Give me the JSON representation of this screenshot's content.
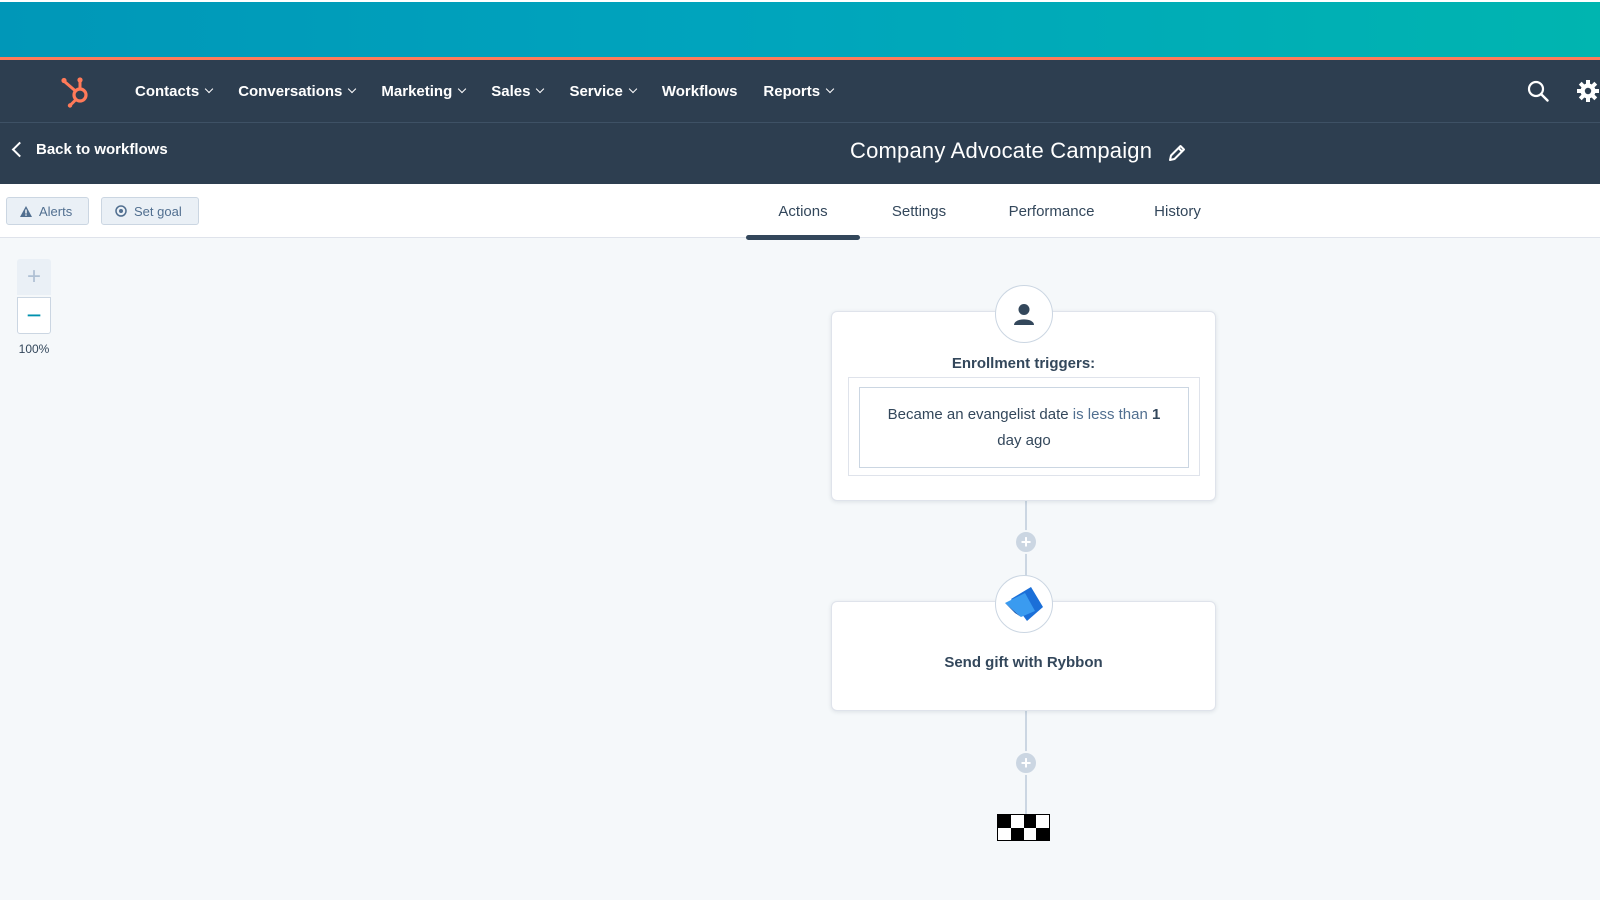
{
  "nav": {
    "items": [
      {
        "label": "Contacts",
        "dropdown": true
      },
      {
        "label": "Conversations",
        "dropdown": true
      },
      {
        "label": "Marketing",
        "dropdown": true
      },
      {
        "label": "Sales",
        "dropdown": true
      },
      {
        "label": "Service",
        "dropdown": true
      },
      {
        "label": "Workflows",
        "dropdown": false
      },
      {
        "label": "Reports",
        "dropdown": true
      }
    ],
    "icons": {
      "logo": "hubspot-sprocket-icon",
      "search": "search-icon",
      "settings": "gear-icon"
    }
  },
  "subheader": {
    "back_label": "Back to workflows",
    "title": "Company Advocate Campaign"
  },
  "toolbar": {
    "alerts_label": "Alerts",
    "set_goal_label": "Set goal"
  },
  "tabs": [
    {
      "label": "Actions",
      "active": true
    },
    {
      "label": "Settings",
      "active": false
    },
    {
      "label": "Performance",
      "active": false
    },
    {
      "label": "History",
      "active": false
    }
  ],
  "zoom": {
    "plus": "+",
    "minus": "−",
    "level": "100%"
  },
  "workflow": {
    "trigger": {
      "title": "Enrollment triggers:",
      "property": "Became an evangelist date",
      "operator": "is less than",
      "value": "1",
      "unit": "day ago"
    },
    "action": {
      "title": "Send gift with Rybbon"
    },
    "add_step_symbol": "+"
  },
  "colors": {
    "banner": "#00a4bd",
    "accent": "#ff7a59",
    "nav_bg": "#2d3e50",
    "canvas_bg": "#f5f8fa",
    "text": "#33475b",
    "connector": "#cbd6e2"
  }
}
